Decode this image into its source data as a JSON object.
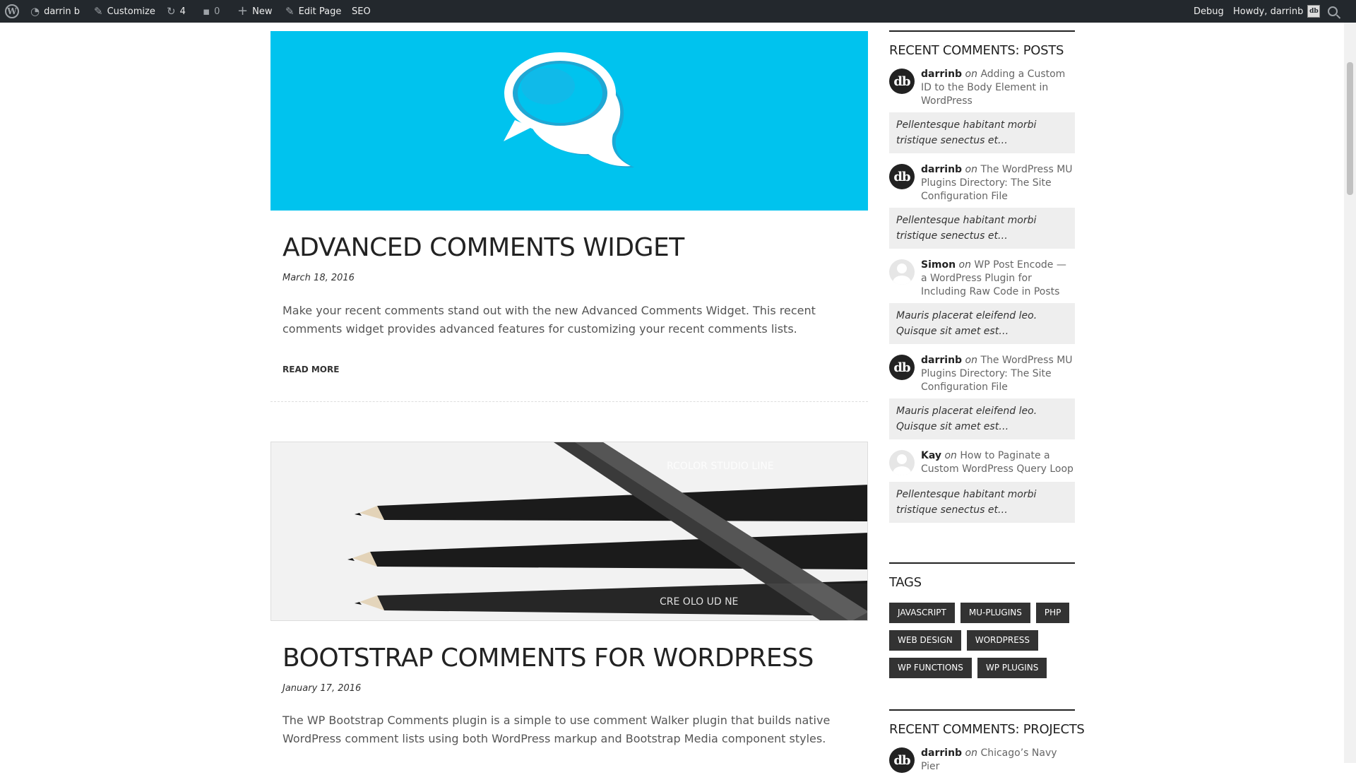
{
  "admin_bar": {
    "site_name": "darrin b",
    "customize": "Customize",
    "updates_count": "4",
    "comments_count": "0",
    "new_label": "New",
    "edit_page": "Edit Page",
    "seo": "SEO",
    "debug": "Debug",
    "howdy": "Howdy, darrinb",
    "avatar_initials": "db"
  },
  "posts": [
    {
      "title": "ADVANCED COMMENTS WIDGET",
      "date": "March 18, 2016",
      "excerpt": "Make your recent comments stand out with the new Advanced Comments Widget. This recent comments widget provides advanced features for customizing your recent comments lists.",
      "read_more": "READ MORE",
      "image_color": "#00c3ee"
    },
    {
      "title": "BOOTSTRAP COMMENTS FOR WORDPRESS",
      "date": "January 17, 2016",
      "excerpt": "The WP Bootstrap Comments plugin is a simple to use comment Walker plugin that builds native WordPress comment lists using both WordPress markup and Bootstrap Media component styles."
    }
  ],
  "sidebar": {
    "recent_posts_title": "RECENT COMMENTS: POSTS",
    "on_word": "on",
    "comments": [
      {
        "author": "darrinb",
        "avatar": "db",
        "post": "Adding a Custom ID to the Body Element in WordPress",
        "excerpt": "Pellentesque habitant morbi tristique senectus et…"
      },
      {
        "author": "darrinb",
        "avatar": "db",
        "post": "The WordPress MU Plugins Directory: The Site Configuration File",
        "excerpt": "Pellentesque habitant morbi tristique senectus et…"
      },
      {
        "author": "Simon",
        "avatar": "",
        "post": "WP Post Encode — a WordPress Plugin for Including Raw Code in Posts",
        "excerpt": "Mauris placerat eleifend leo. Quisque sit amet est…"
      },
      {
        "author": "darrinb",
        "avatar": "db",
        "post": "The WordPress MU Plugins Directory: The Site Configuration File",
        "excerpt": "Mauris placerat eleifend leo. Quisque sit amet est…"
      },
      {
        "author": "Kay",
        "avatar": "",
        "post": "How to Paginate a Custom WordPress Query Loop",
        "excerpt": "Pellentesque habitant morbi tristique senectus et…"
      }
    ],
    "tags_title": "TAGS",
    "tags": [
      "JAVASCRIPT",
      "MU-PLUGINS",
      "PHP",
      "WEB DESIGN",
      "WORDPRESS",
      "WP FUNCTIONS",
      "WP PLUGINS"
    ],
    "recent_projects_title": "RECENT COMMENTS: PROJECTS",
    "project_comment": {
      "author": "darrinb",
      "avatar": "db",
      "post": "Chicago’s Navy Pier"
    }
  },
  "colors": {
    "admin_bar": "#23282d",
    "hero_blue": "#00c3ee",
    "tag_bg": "#333333"
  }
}
